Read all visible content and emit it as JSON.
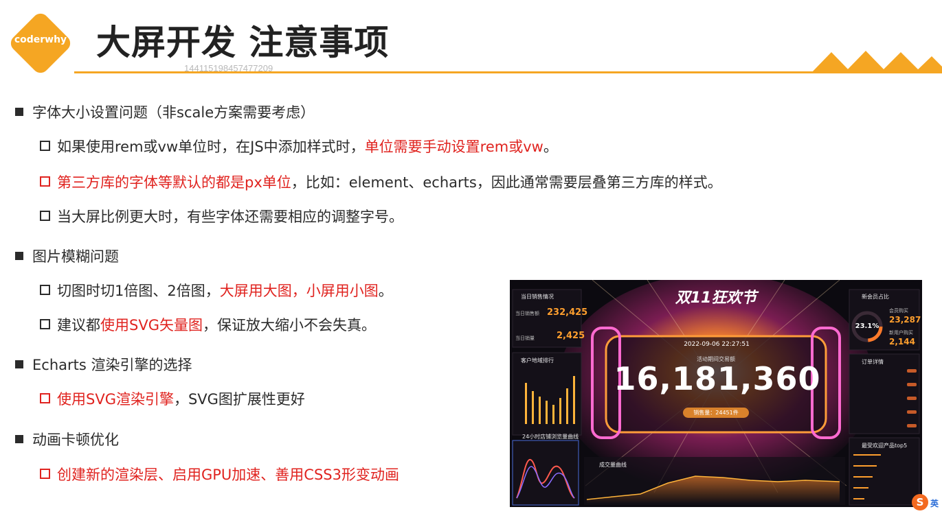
{
  "header": {
    "logo_text": "coderwhy",
    "title": "大屏开发 注意事项",
    "watermark": "144115198457477209"
  },
  "bullets": [
    {
      "text": "字体大小设置问题（非scale方案需要考虑）"
    },
    {
      "pre": "如果使用rem或vw单位时，在JS中添加样式时，",
      "red": "单位需要手动设置rem或vw",
      "post": "。"
    },
    {
      "red": "第三方库的字体等默认的都是px单位",
      "post": "，比如：element、echarts，因此通常需要层叠第三方库的样式。"
    },
    {
      "text": "当大屏比例更大时，有些字体还需要相应的调整字号。"
    },
    {
      "text": "图片模糊问题"
    },
    {
      "pre": "切图时切1倍图、2倍图，",
      "red": "大屏用大图，小屏用小图",
      "post": "。"
    },
    {
      "pre": "建议都",
      "red": "使用SVG矢量图",
      "post": "，保证放大缩小不会失真。"
    },
    {
      "text": "Echarts 渲染引擎的选择"
    },
    {
      "red": "使用SVG渲染引擎",
      "post": "，SVG图扩展性更好"
    },
    {
      "text": "动画卡顿优化"
    },
    {
      "red": "创建新的渲染层、启用GPU加速、善用CSS3形变动画"
    }
  ],
  "dashboard": {
    "title": "双11狂欢节",
    "datetime": "2022-09-06 22:27:51",
    "subtitle": "活动期间交易额",
    "amount": "16,181,360",
    "sales_pill": "销售量：24451件",
    "left_panel_title": "当日销售情况",
    "today_amount_label": "当日销售额",
    "today_amount": "232,425",
    "today_sales_label": "当日销量",
    "today_sales": "2,425",
    "region_title": "客户地域排行",
    "curve_title": "24小时店铺浏览量曲线",
    "volume_title": "成交量曲线",
    "members_title": "新会员占比",
    "members_pct": "23.1%",
    "members_label1": "会员购买",
    "members_value1": "23,287",
    "members_label2": "新用户购买",
    "members_value2": "2,144",
    "orders_title": "订单详情",
    "top5_title": "最受欢迎产品top5"
  },
  "colors": {
    "accent": "#f5a623",
    "highlight": "#e0231f",
    "dash_orange": "#ff9f2e"
  },
  "ime": {
    "icon": "S",
    "lang": "英"
  }
}
